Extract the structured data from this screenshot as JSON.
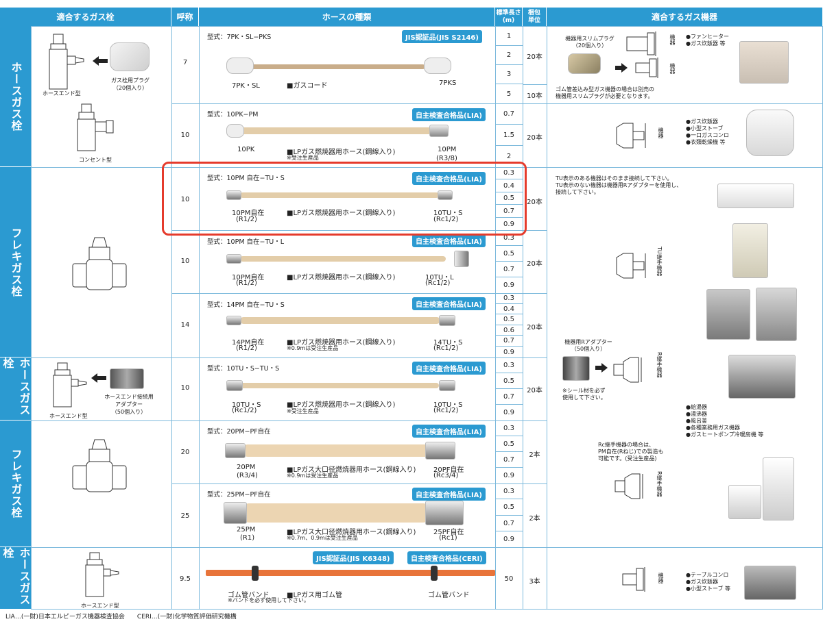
{
  "header": {
    "col1": "適合するガス栓",
    "col2": "呼称",
    "col3": "ホースの種類",
    "col4a": "標準長さ",
    "col4b": "(m)",
    "col5a": "梱包",
    "col5b": "単位",
    "col6": "適合するガス機器"
  },
  "sidebar": {
    "s1": "ホースガス栓",
    "s2": "フレキガス栓",
    "s3": "ホースガス栓",
    "s4": "フレキガス栓",
    "s5": "ホースガス栓"
  },
  "left": {
    "plug1": "ガス栓用プラグ",
    "plug2": "（20個入り）",
    "hoseend": "ホースエンド型",
    "consent": "コンセント型",
    "adp1": "ホースエンド接続用",
    "adp2": "アダプター",
    "adp3": "（50個入り）",
    "hoseend2": "ホースエンド型",
    "hoseend3": "ホースエンド型"
  },
  "rows": [
    {
      "size": "7",
      "model": "型式：7PK・SL−PKS",
      "badge": "JIS認証品(JIS S2146)",
      "leftlabel": "7PK・SL",
      "leftlabel2": "",
      "center": "■ガスコード",
      "centernote": "",
      "rightlabel": "7PKS",
      "rightlabel2": "",
      "lengths": [
        "1",
        "2",
        "3",
        "5"
      ],
      "pack": [
        "20本",
        "10本"
      ]
    },
    {
      "size": "10",
      "model": "型式：10PK−PM",
      "badge": "自主検査合格品(LIA)",
      "leftlabel": "10PK",
      "leftlabel2": "",
      "center": "■LPガス燃焼器用ホース(鋼線入り)",
      "centernote": "※受注生産品",
      "rightlabel": "10PM",
      "rightlabel2": "(R3/8)",
      "lengths": [
        "0.7",
        "1.5",
        "2"
      ],
      "pack": [
        "20本"
      ]
    },
    {
      "size": "10",
      "model": "型式：10PM 自在−TU・S",
      "badge": "自主検査合格品(LIA)",
      "leftlabel": "10PM自在",
      "leftlabel2": "(R1/2)",
      "center": "■LPガス燃焼器用ホース(鋼線入り)",
      "centernote": "",
      "rightlabel": "10TU・S",
      "rightlabel2": "(Rc1/2)",
      "lengths": [
        "0.3",
        "0.4",
        "0.5",
        "0.7",
        "0.9"
      ],
      "pack": [
        "20本"
      ]
    },
    {
      "size": "10",
      "model": "型式：10PM 自在−TU・L",
      "badge": "自主検査合格品(LIA)",
      "leftlabel": "10PM自在",
      "leftlabel2": "(R1/2)",
      "center": "■LPガス燃焼器用ホース(鋼線入り)",
      "centernote": "",
      "rightlabel": "10TU・L",
      "rightlabel2": "(Rc1/2)",
      "lengths": [
        "0.3",
        "0.5",
        "0.7",
        "0.9"
      ],
      "pack": [
        "20本"
      ]
    },
    {
      "size": "14",
      "model": "型式：14PM 自在−TU・S",
      "badge": "自主検査合格品(LIA)",
      "leftlabel": "14PM自在",
      "leftlabel2": "(R1/2)",
      "center": "■LPガス燃焼器用ホース(鋼線入り)",
      "centernote": "※0.9mは受注生産品",
      "rightlabel": "14TU・S",
      "rightlabel2": "(Rc1/2)",
      "lengths": [
        "0.3",
        "0.4",
        "0.5",
        "0.6",
        "0.7",
        "0.9"
      ],
      "pack": [
        "20本"
      ]
    },
    {
      "size": "10",
      "model": "型式：10TU・S−TU・S",
      "badge": "自主検査合格品(LIA)",
      "leftlabel": "10TU・S",
      "leftlabel2": "(Rc1/2)",
      "center": "■LPガス燃焼器用ホース(鋼線入り)",
      "centernote": "※受注生産品",
      "rightlabel": "10TU・S",
      "rightlabel2": "(Rc1/2)",
      "lengths": [
        "0.3",
        "0.5",
        "0.7",
        "0.9"
      ],
      "pack": [
        "20本"
      ]
    },
    {
      "size": "20",
      "model": "型式：20PM−PF自在",
      "badge": "自主検査合格品(LIA)",
      "leftlabel": "20PM",
      "leftlabel2": "(R3/4)",
      "center": "■LPガス大口径燃焼器用ホース(鋼線入り)",
      "centernote": "※0.9mは受注生産品",
      "rightlabel": "20PF自在",
      "rightlabel2": "(Rc3/4)",
      "lengths": [
        "0.3",
        "0.5",
        "0.7",
        "0.9"
      ],
      "pack": [
        "2本"
      ]
    },
    {
      "size": "25",
      "model": "型式：25PM−PF自在",
      "badge": "自主検査合格品(LIA)",
      "leftlabel": "25PM",
      "leftlabel2": "(R1)",
      "center": "■LPガス大口径燃焼器用ホース(鋼線入り)",
      "centernote": "※0.7m、0.9mは受注生産品",
      "rightlabel": "25PF自在",
      "rightlabel2": "(Rc1)",
      "lengths": [
        "0.3",
        "0.5",
        "0.7",
        "0.9"
      ],
      "pack": [
        "2本"
      ]
    },
    {
      "size": "9.5",
      "model": "",
      "badge": "JIS認証品(JIS K6348)",
      "badge2": "自主検査合格品(CERI)",
      "leftlabel": "ゴム管バンド",
      "leftlabel2": "",
      "center": "■LPガス用ゴム管",
      "centernote": "※バンドを必ず使用して下さい。",
      "rightlabel": "ゴム管バンド",
      "rightlabel2": "",
      "lengths": [
        "50"
      ],
      "pack": [
        "3本"
      ]
    }
  ],
  "right": {
    "slimplug1": "機器用スリムプラグ",
    "slimplug2": "（20個入り）",
    "kiki": "機器",
    "list1": [
      "●ファンヒーター",
      "●ガス炊飯器 等"
    ],
    "note1a": "ゴム管差込み型ガス機器の場合は別売の",
    "note1b": "機器用スリムプラグが必要となります。",
    "list2": [
      "●ガス炊飯器",
      "●小型ストーブ",
      "●一口ガスコンロ",
      "●衣類乾燥機 等"
    ],
    "tu1": "TU表示のある機器はそのまま接続して下さい。",
    "tu2": "TU表示のない機器は機器用Rアダプターを使用し、",
    "tu3": "接続して下さい。",
    "tukiki": "TU継手機器",
    "radp1": "機器用Rアダプター",
    "radp2": "（50個入り）",
    "rkiki": "R継手機器",
    "seal1": "※シール材を必ず",
    "seal2": "使用して下さい。",
    "list3": [
      "●給湯器",
      "●湯沸器",
      "●風呂釜",
      "●各種業務用ガス機器",
      "●ガスヒートポンプ冷暖房機 等"
    ],
    "rc1": "Rc継手機器の場合は、",
    "rc2": "PM自在(Rねじ)での製造も",
    "rc3": "可能です。(受注生産品)",
    "rkiki2": "R継手機器",
    "kiki2": "機器",
    "list4": [
      "●テーブルコンロ",
      "●ガス炊飯器",
      "●小型ストーブ 等"
    ]
  },
  "footer": "LIA…(一財)日本エルピーガス機器検査協会　　CERI…(一財)化学物質評価研究機構",
  "colors": {
    "accent": "#2b9ad1",
    "highlight": "#e53b2c",
    "hose": "#e8d4b4",
    "rubber": "#e8743a"
  }
}
